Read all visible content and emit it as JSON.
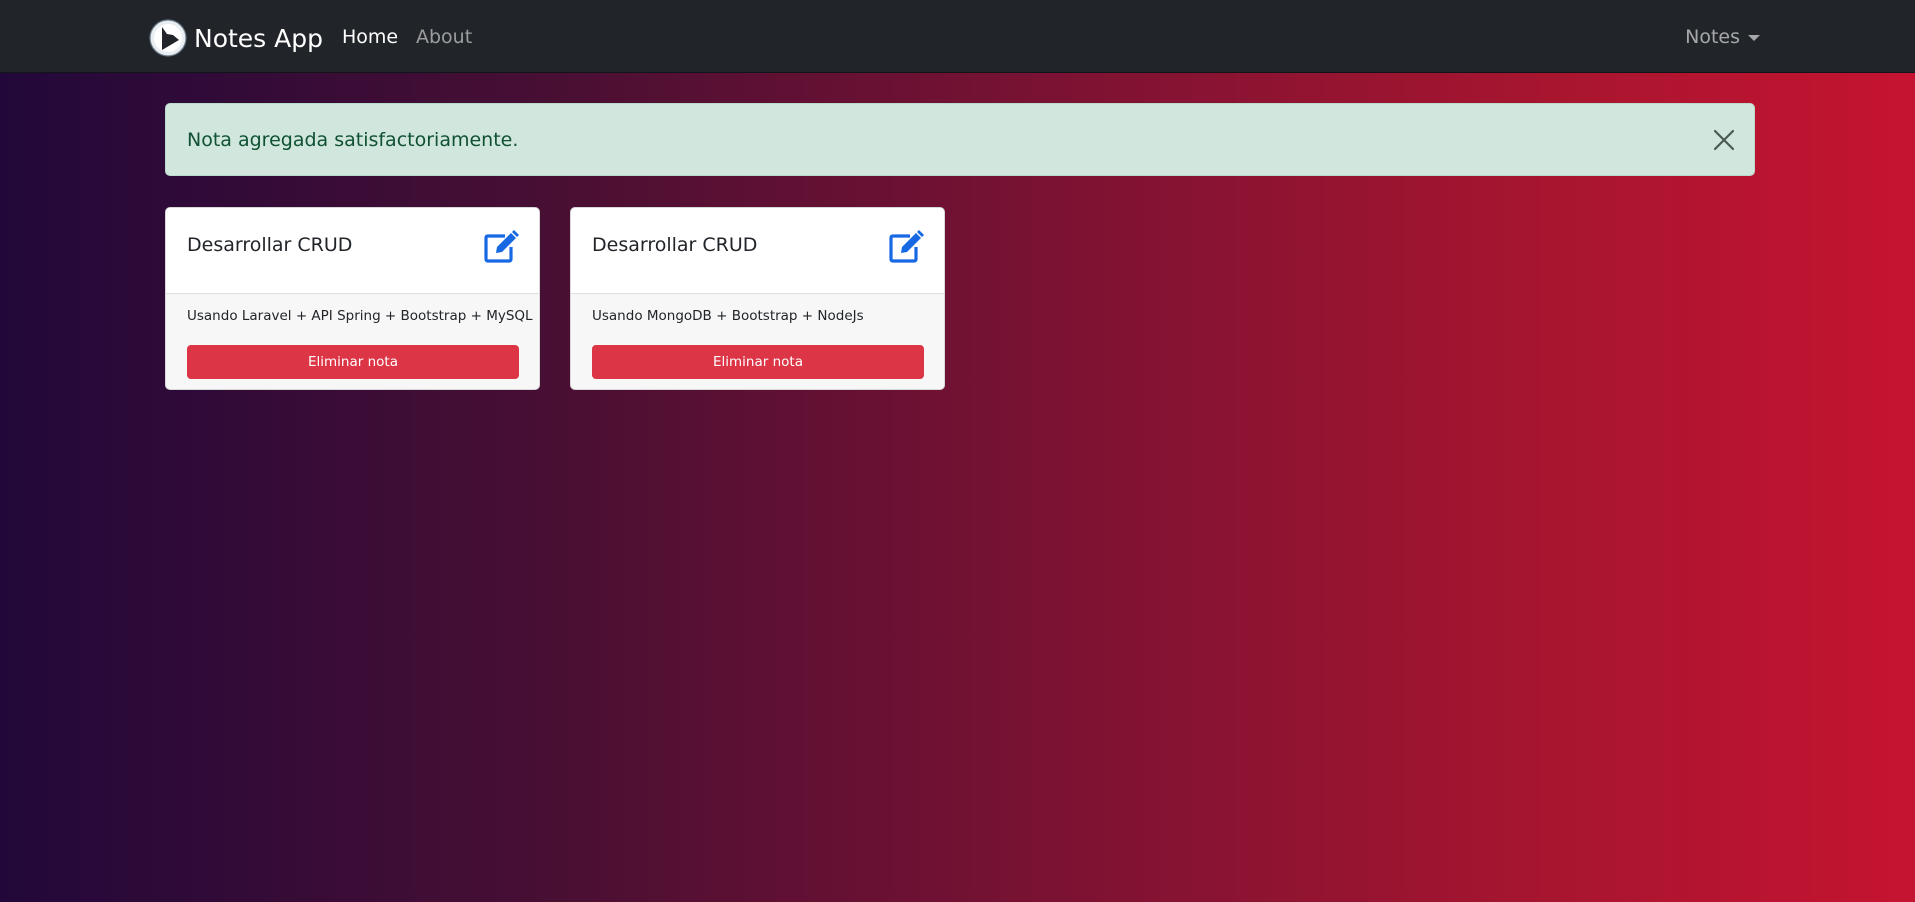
{
  "navbar": {
    "brand": "Notes App",
    "links": [
      {
        "label": "Home",
        "active": true
      },
      {
        "label": "About",
        "active": false
      }
    ],
    "dropdown_label": "Notes"
  },
  "alert": {
    "message": "Nota agregada satisfactoriamente.",
    "type": "success"
  },
  "notes": [
    {
      "title": "Desarrollar CRUD",
      "description": "Usando Laravel + API Spring + Bootstrap + MySQL",
      "delete_label": "Eliminar nota",
      "icon": "edit-icon"
    },
    {
      "title": "Desarrollar CRUD",
      "description": "Usando MongoDB + Bootstrap + NodeJs",
      "delete_label": "Eliminar nota",
      "icon": "edit-icon"
    }
  ],
  "colors": {
    "navbar_bg": "#212529",
    "gradient_start": "#22083a",
    "gradient_end": "#c51431",
    "alert_bg": "#d1e7dd",
    "alert_text": "#0f5132",
    "danger": "#dc3545",
    "edit_icon": "#0d6efd"
  }
}
